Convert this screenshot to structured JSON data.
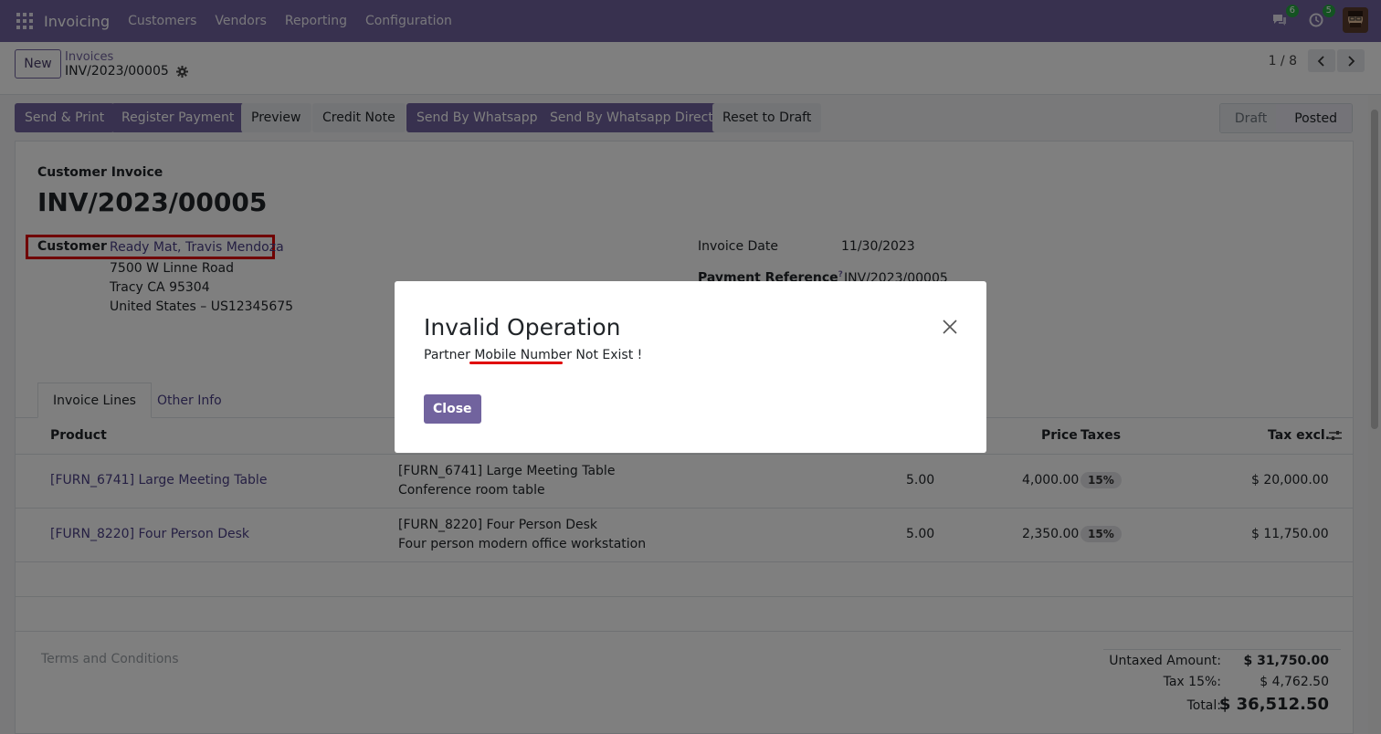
{
  "navbar": {
    "app_name": "Invoicing",
    "menu": [
      "Customers",
      "Vendors",
      "Reporting",
      "Configuration"
    ],
    "messages_count": "6",
    "activities_count": "5"
  },
  "control_panel": {
    "new_label": "New",
    "breadcrumb_parent": "Invoices",
    "breadcrumb_current": "INV/2023/00005",
    "pager": "1 / 8"
  },
  "actions": {
    "send_print": "Send & Print",
    "register_payment": "Register Payment",
    "preview": "Preview",
    "credit_note": "Credit Note",
    "send_whatsapp": "Send By Whatsapp",
    "send_whatsapp_direct": "Send By Whatsapp Direct",
    "reset_draft": "Reset to Draft"
  },
  "status": {
    "draft": "Draft",
    "posted": "Posted"
  },
  "invoice": {
    "type": "Customer Invoice",
    "number": "INV/2023/00005",
    "customer_label": "Customer",
    "customer_name": "Ready Mat, Travis Mendoza",
    "address_line1": "7500 W Linne Road",
    "address_line2": "Tracy CA 95304",
    "address_line3": "United States – US12345675",
    "invoice_date_label": "Invoice Date",
    "invoice_date": "11/30/2023",
    "payment_ref_label": "Payment Reference",
    "payment_ref_help": "?",
    "payment_ref": "INV/2023/00005"
  },
  "tabs": {
    "lines": "Invoice Lines",
    "other": "Other Info"
  },
  "table": {
    "headers": {
      "product": "Product",
      "price": "Price",
      "taxes": "Taxes",
      "tax_excl": "Tax excl."
    },
    "rows": [
      {
        "product": "[FURN_6741] Large Meeting Table",
        "label_line1": "[FURN_6741] Large Meeting Table",
        "label_line2": "Conference room table",
        "quantity": "5.00",
        "price": "4,000.00",
        "tax": "15%",
        "subtotal": "$ 20,000.00"
      },
      {
        "product": "[FURN_8220] Four Person Desk",
        "label_line1": "[FURN_8220] Four Person Desk",
        "label_line2": "Four person modern office workstation",
        "quantity": "5.00",
        "price": "2,350.00",
        "tax": "15%",
        "subtotal": "$ 11,750.00"
      }
    ]
  },
  "terms_placeholder": "Terms and Conditions",
  "totals": {
    "untaxed_label": "Untaxed Amount:",
    "untaxed_value": "$ 31,750.00",
    "tax_label": "Tax 15%:",
    "tax_value": "$ 4,762.50",
    "total_label": "Total:",
    "total_value": "$ 36,512.50"
  },
  "dialog": {
    "title": "Invalid Operation",
    "message_prefix": "Partner ",
    "message_highlight": "Mobile Number",
    "message_suffix": " Not Exist !",
    "close_label": "Close"
  },
  "colors": {
    "brand": "#71639e",
    "highlight": "#e00000"
  }
}
